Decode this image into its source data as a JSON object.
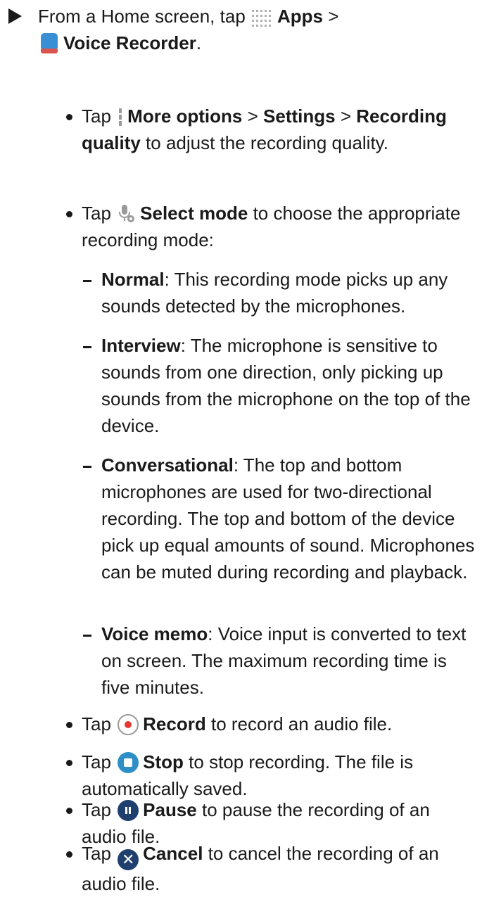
{
  "step": {
    "prefix": "From a Home screen, tap",
    "apps": "Apps",
    "sep1": ">",
    "voice_recorder": "Voice Recorder",
    "end": "."
  },
  "bullets": [
    {
      "prefix": "Tap",
      "b1": "More options",
      "mid1": ">",
      "b2": "Settings",
      "mid2": ">",
      "b3": "Recording quality",
      "suffix": "to adjust the recording quality."
    },
    {
      "prefix": "Tap",
      "label": "Select mode",
      "suffix": "to choose the appropriate recording mode:"
    },
    {
      "prefix": "Tap",
      "label": "Record",
      "suffix": "to record an audio file."
    },
    {
      "prefix": "Tap",
      "label": "Stop",
      "suffix": "to stop recording. The file is automatically saved."
    },
    {
      "prefix": "Tap",
      "label": "Pause",
      "suffix": "to pause the recording of an audio file."
    },
    {
      "prefix": "Tap",
      "label": "Cancel",
      "suffix": "to cancel the recording of an audio file."
    }
  ],
  "modes": [
    {
      "name": "Normal",
      "desc": ": This recording mode picks up any sounds detected by the microphones."
    },
    {
      "name": "Interview",
      "desc": ": The microphone is sensitive to sounds from one direction, only picking up sounds from the microphone on the top of the device."
    },
    {
      "name": "Conversational",
      "desc": ": The top and bottom microphones are used for two-directional recording. The top and bottom of the device pick up equal amounts of sound. Microphones can be muted during recording and playback."
    },
    {
      "name": "Voice memo",
      "desc": ": Voice input is converted to text on screen. The maximum recording time is five minutes."
    }
  ],
  "icons": {
    "cancel_glyph": "✕"
  }
}
